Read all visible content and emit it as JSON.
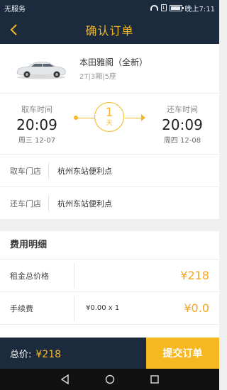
{
  "status_bar": {
    "carrier": "无服务",
    "sim_label": "1",
    "time_label": "晚上7:11"
  },
  "header": {
    "title": "确认订单"
  },
  "car": {
    "name": "本田雅阁（全新）",
    "spec": "2T|3厢|5座"
  },
  "pickup": {
    "label": "取车时间",
    "time": "20:09",
    "date": "周三 12-07"
  },
  "return": {
    "label": "还车时间",
    "time": "20:09",
    "date": "周四 12-08"
  },
  "duration": {
    "days": "1",
    "unit": "天"
  },
  "stores": [
    {
      "label": "取车门店",
      "value": "杭州东站便利点"
    },
    {
      "label": "还车门店",
      "value": "杭州东站便利点"
    }
  ],
  "fees": {
    "title": "费用明细",
    "rows": [
      {
        "label": "租金总价格",
        "detail": "",
        "amount": "¥218"
      },
      {
        "label": "手续费",
        "detail": "¥0.00 x 1",
        "amount": "¥0.0"
      }
    ]
  },
  "footer": {
    "total_label": "总价:",
    "total_amount": "¥218",
    "submit_label": "提交订单"
  },
  "colors": {
    "accent": "#f5b820",
    "navy": "#1b2a3c",
    "price": "#f5a623"
  }
}
